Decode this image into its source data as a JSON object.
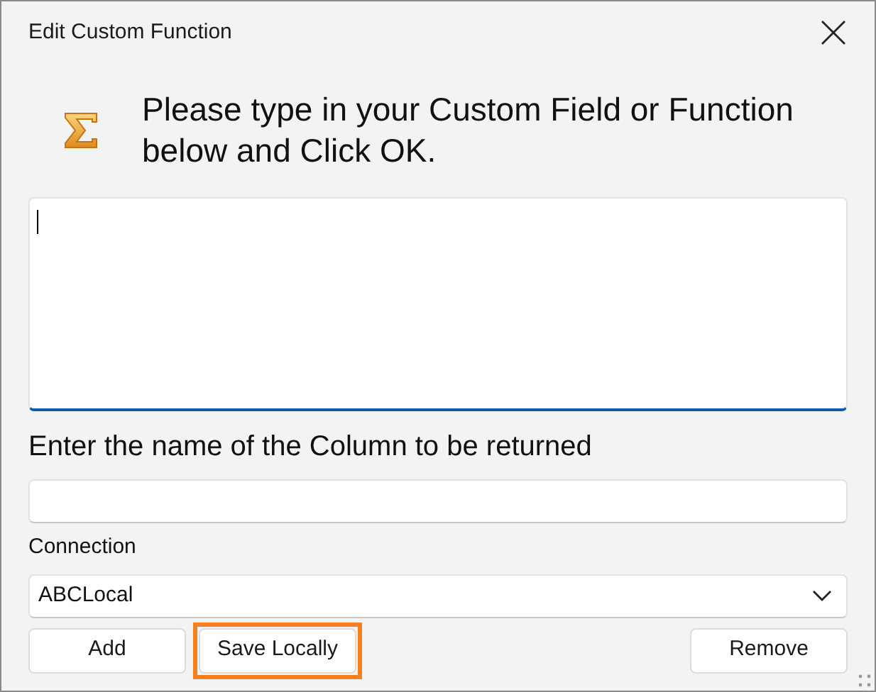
{
  "window": {
    "title": "Edit Custom Function"
  },
  "prompt": "Please type in your Custom Field or Function below and Click OK.",
  "function_editor": {
    "focused": true
  },
  "column_field": {
    "label": "Enter the name of the Column to be returned"
  },
  "connection": {
    "label": "Connection",
    "value": "ABCLocal"
  },
  "left_buttons": [
    {
      "label": "Add",
      "highlighted": false
    },
    {
      "label": "Save Locally",
      "highlighted": true
    }
  ],
  "right_buttons": [
    {
      "label": "Remove",
      "highlighted": false
    }
  ]
}
